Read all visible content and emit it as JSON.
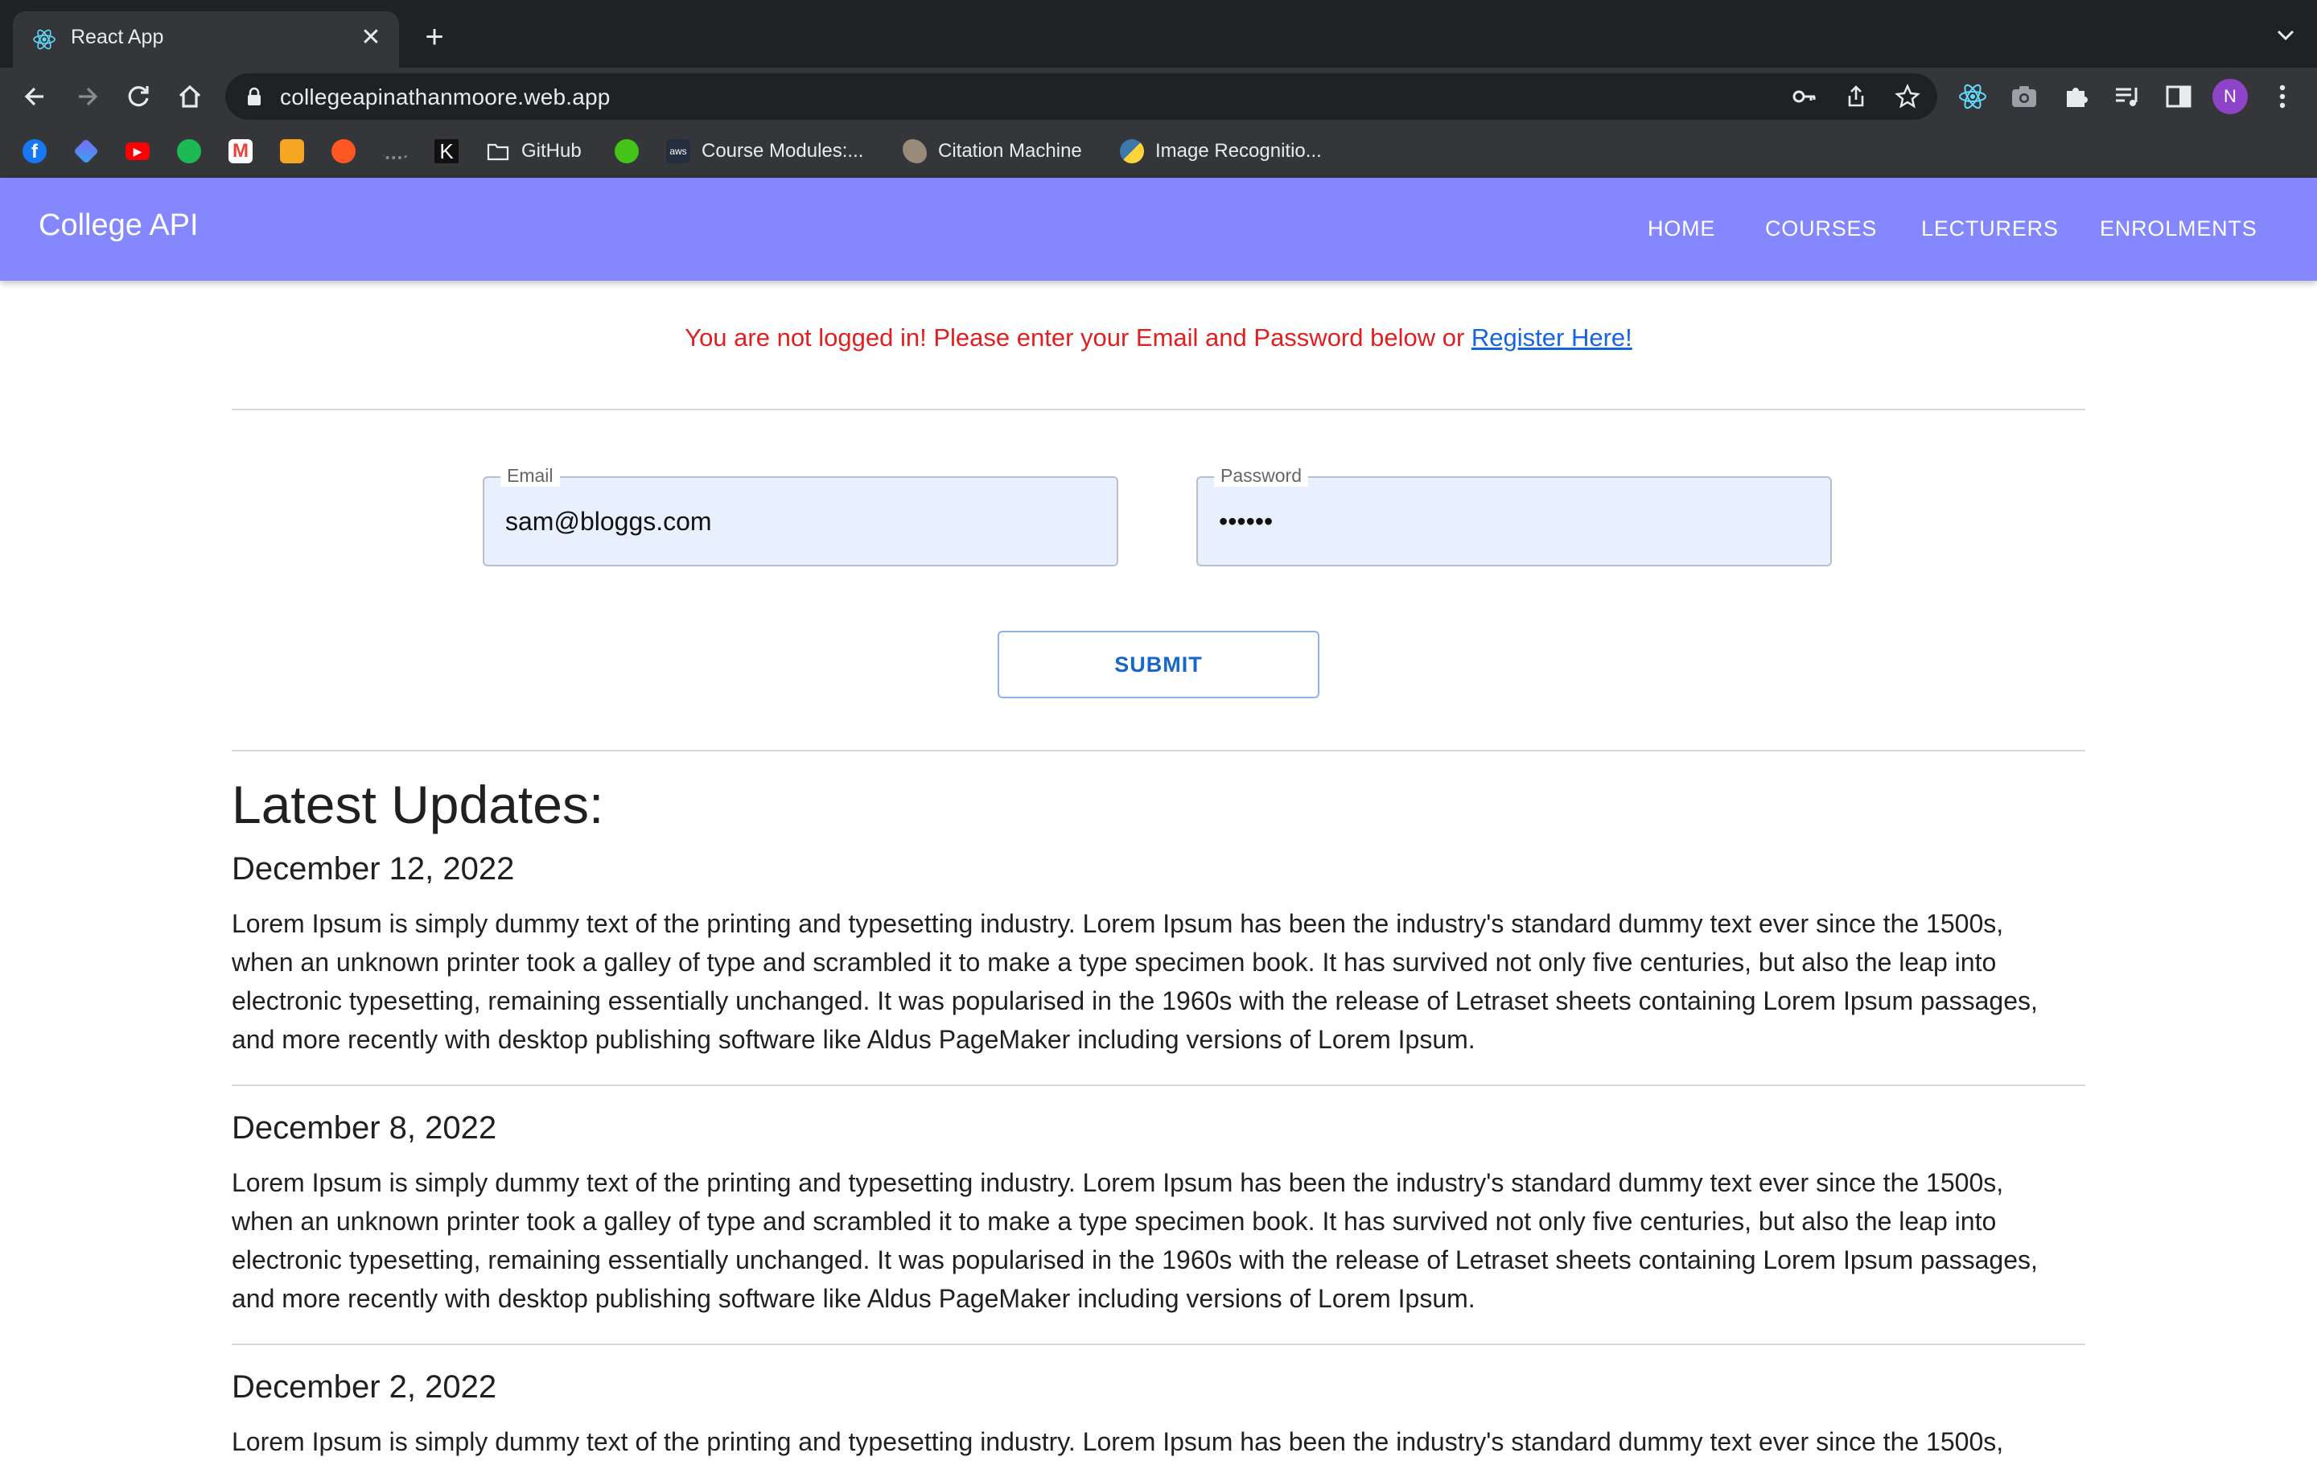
{
  "browser": {
    "tab_title": "React App",
    "url": "collegeapinathanmoore.web.app",
    "profile_initial": "N",
    "bookmarks": [
      {
        "label": "",
        "icon": "facebook-icon",
        "color": "#1877f2"
      },
      {
        "label": "",
        "icon": "app-icon",
        "color": "#5b6ee1"
      },
      {
        "label": "",
        "icon": "youtube-icon",
        "color": "#ff0000"
      },
      {
        "label": "",
        "icon": "spotify-icon",
        "color": "#1db954"
      },
      {
        "label": "",
        "icon": "gmail-icon",
        "color": "#ea4335"
      },
      {
        "label": "",
        "icon": "notes-icon",
        "color": "#f5a623"
      },
      {
        "label": "",
        "icon": "circle-icon",
        "color": "#ff5722"
      },
      {
        "label": "",
        "icon": "cisco-icon",
        "color": "#8a8a8a"
      },
      {
        "label": "",
        "icon": "k-icon",
        "color": "#000000"
      },
      {
        "label": "GitHub",
        "icon": "folder-icon",
        "color": "#e8eaed"
      },
      {
        "label": "",
        "icon": "globe-icon",
        "color": "#43c417"
      },
      {
        "label": "Course Modules:...",
        "icon": "aws-icon",
        "color": "#232f3e"
      },
      {
        "label": "Citation Machine",
        "icon": "squirrel-icon",
        "color": "#9a8a7a"
      },
      {
        "label": "Image Recognitio...",
        "icon": "python-icon",
        "color": "#3c78aa"
      }
    ]
  },
  "app": {
    "brand": "College API",
    "nav": [
      "HOME",
      "COURSES",
      "LECTURERS",
      "ENROLMENTS"
    ],
    "notice_text": "You are not logged in! Please enter your Email and Password below or ",
    "notice_link": "Register Here!",
    "email_label": "Email",
    "email_value": "sam@bloggs.com",
    "password_label": "Password",
    "password_value": "••••••",
    "submit_label": "SUBMIT",
    "updates_title": "Latest Updates:",
    "updates": [
      {
        "date": "December 12, 2022",
        "lines": [
          "Lorem Ipsum is simply dummy text of the printing and typesetting industry. Lorem Ipsum has been the industry's standard dummy text ever since the 1500s,",
          "when an unknown printer took a galley of type and scrambled it to make a type specimen book. It has survived not only five centuries, but also the leap into",
          "electronic typesetting, remaining essentially unchanged. It was popularised in the 1960s with the release of Letraset sheets containing Lorem Ipsum passages,",
          "and more recently with desktop publishing software like Aldus PageMaker including versions of Lorem Ipsum."
        ]
      },
      {
        "date": "December 8, 2022",
        "lines": [
          "Lorem Ipsum is simply dummy text of the printing and typesetting industry. Lorem Ipsum has been the industry's standard dummy text ever since the 1500s,",
          "when an unknown printer took a galley of type and scrambled it to make a type specimen book. It has survived not only five centuries, but also the leap into",
          "electronic typesetting, remaining essentially unchanged. It was popularised in the 1960s with the release of Letraset sheets containing Lorem Ipsum passages,",
          "and more recently with desktop publishing software like Aldus PageMaker including versions of Lorem Ipsum."
        ]
      },
      {
        "date": "December 2, 2022",
        "lines": [
          "Lorem Ipsum is simply dummy text of the printing and typesetting industry. Lorem Ipsum has been the industry's standard dummy text ever since the 1500s,"
        ]
      }
    ]
  }
}
